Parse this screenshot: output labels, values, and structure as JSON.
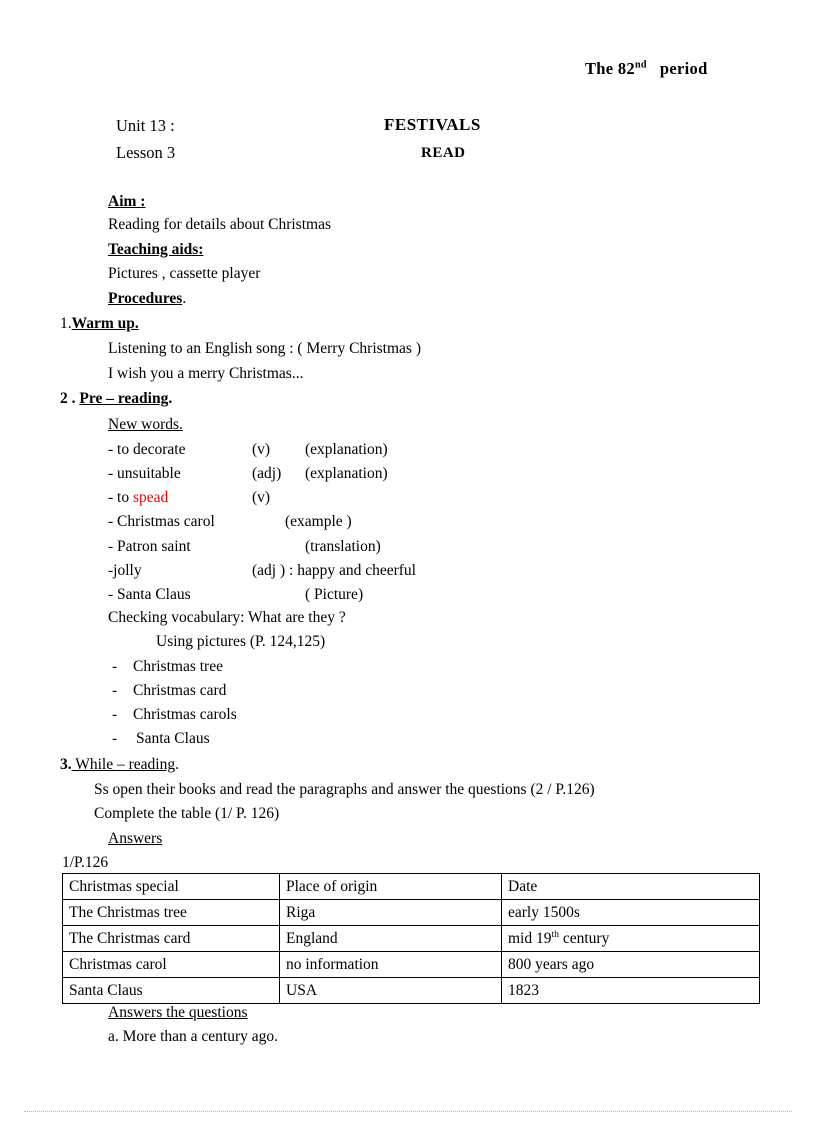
{
  "header": {
    "period": "The 82",
    "period_sup": "nd",
    "period_tail": "period",
    "unit": "Unit 13 :",
    "lesson": "Lesson 3",
    "title": "FESTIVALS",
    "subtitle": "READ"
  },
  "aim": {
    "heading": "Aim :",
    "text": "Reading for details about Christmas"
  },
  "teaching_aids": {
    "heading": "Teaching aids:",
    "text": "Pictures , cassette player"
  },
  "procedures": {
    "heading": "Procedures",
    "trailing": "."
  },
  "warm_up": {
    "number": "1.",
    "heading": "Warm up.",
    "lines": [
      "Listening to an English song : ( Merry Christmas )",
      "I wish you a merry Christmas..."
    ]
  },
  "pre_reading": {
    "number": "2 . ",
    "heading": "Pre – reading",
    "trailing": ".",
    "new_words_heading": "New words.",
    "words": [
      {
        "term": "- to decorate",
        "pos": "(v)",
        "note": "(explanation)"
      },
      {
        "term": "- unsuitable",
        "pos": "(adj)",
        "note": "(explanation)"
      },
      {
        "term": "- to ",
        "term_red": "spead",
        "pos": "(v)",
        "note": ""
      },
      {
        "term": "- Christmas  carol",
        "pos": "",
        "note": "(example )"
      },
      {
        "term": "- Patron saint",
        "pos": "",
        "note": "(translation)"
      },
      {
        "term": "-jolly",
        "pos": "(adj ) : happy and cheerful",
        "note": ""
      },
      {
        "term": "- Santa Claus",
        "pos": "",
        "note": "( Picture)"
      }
    ],
    "checking_vocabulary": "Checking vocabulary: What are they ?",
    "using_pictures": "Using pictures  (P. 124,125)",
    "picture_items": [
      "Christmas tree",
      "Christmas card",
      "Christmas carols",
      "Santa Claus"
    ],
    "dash": "-"
  },
  "while_reading": {
    "number": "3.",
    "heading": " While – reading",
    "trailing": ".",
    "lines": [
      "Ss open their books and read the paragraphs and answer the questions (2 / P.126)",
      "Complete the table  (1/ P. 126)"
    ],
    "answers_heading": "Answers",
    "table_caption": "1/P.126"
  },
  "table": {
    "columns": [
      "Christmas special",
      "Place of origin",
      "Date"
    ],
    "rows": [
      [
        "The Christmas tree",
        "Riga",
        "early 1500s"
      ],
      [
        "The Christmas card",
        "England",
        "mid 19|th| century"
      ],
      [
        "Christmas carol",
        "no information",
        "800 years ago"
      ],
      [
        "Santa Claus",
        "USA",
        "1823"
      ]
    ]
  },
  "answers_section": {
    "heading": "Answers the questions",
    "items": [
      "a.  More than a century ago."
    ]
  },
  "colors": {
    "text": "#000000",
    "highlight": "#ff0000",
    "rule": "#b8b8b8"
  }
}
